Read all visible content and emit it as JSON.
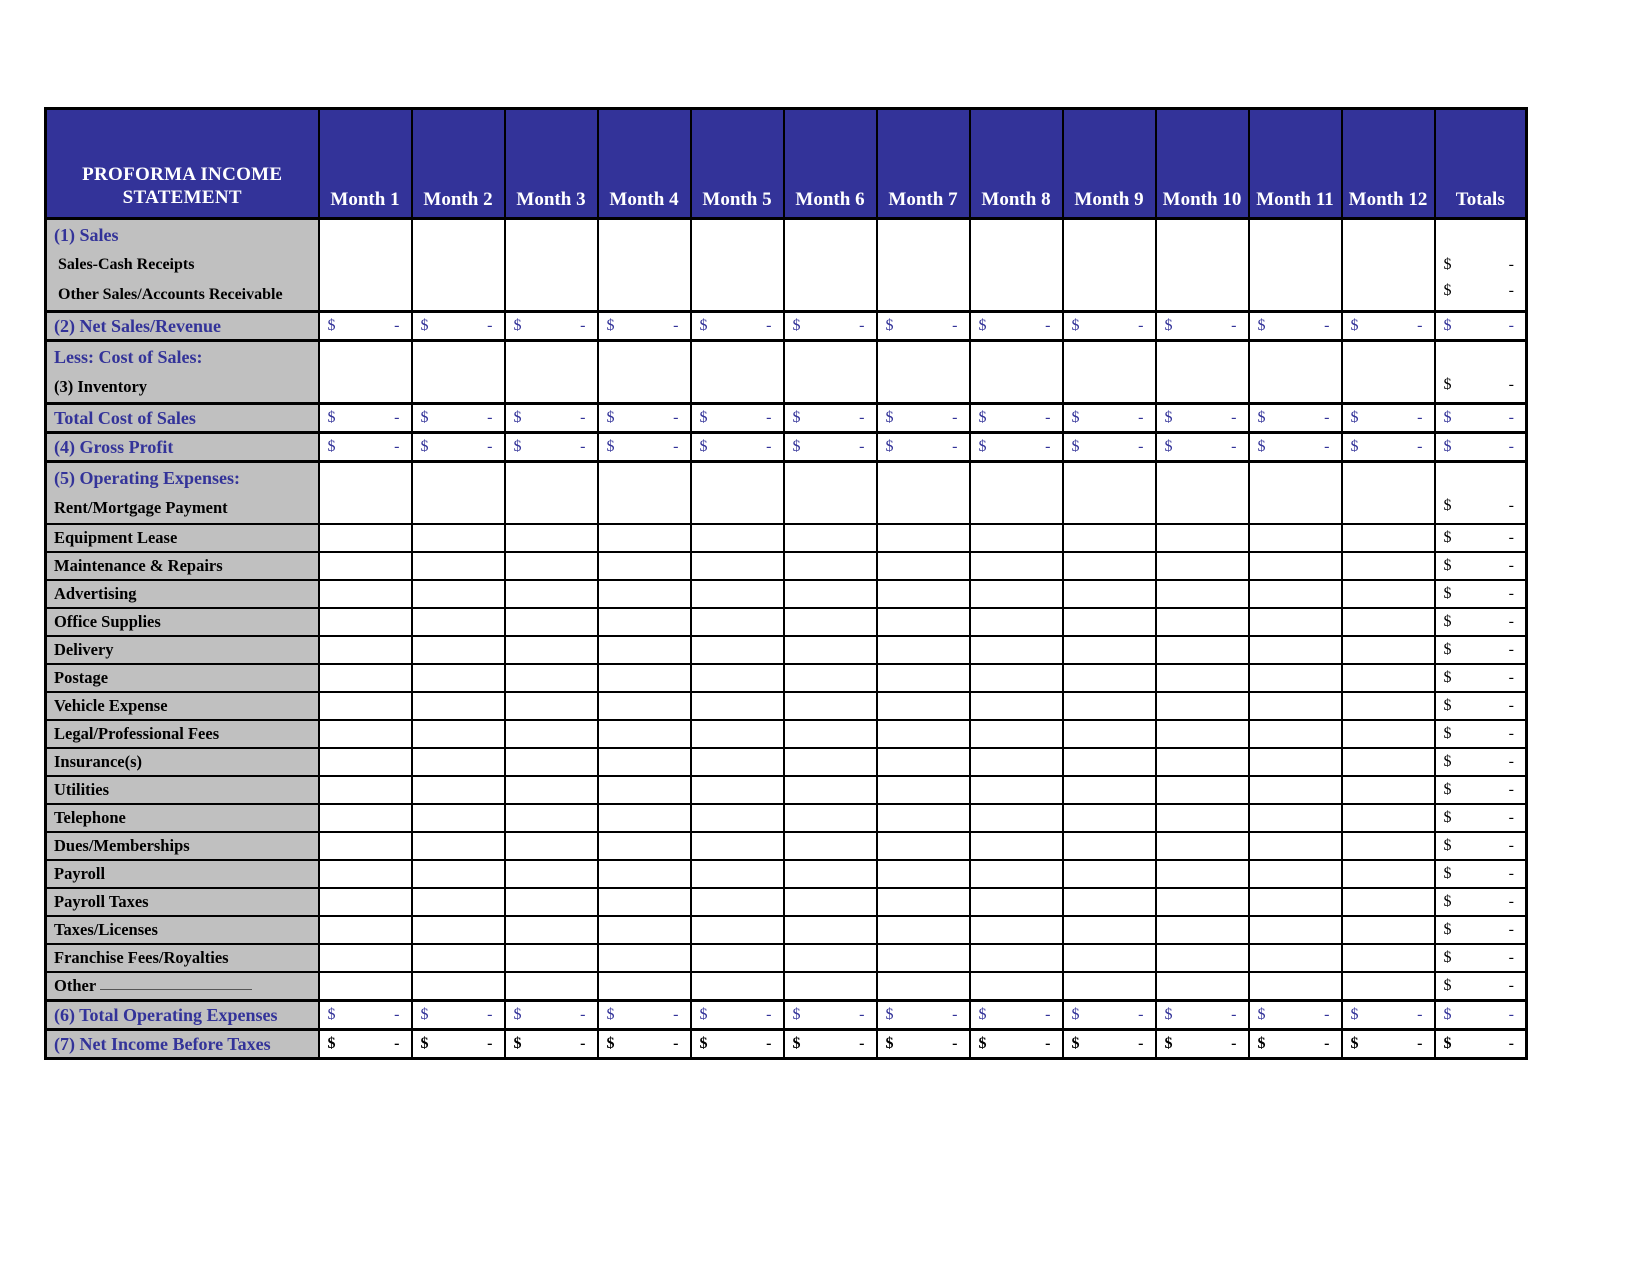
{
  "document": {
    "title_line1": "PROFORMA INCOME",
    "title_line2": "STATEMENT"
  },
  "colors": {
    "header_bg": "#333399",
    "label_bg": "#c0c0c0",
    "accent_text": "#333399",
    "cell_bg": "#ffffff",
    "border": "#000000"
  },
  "columns": {
    "row_header": "PROFORMA INCOME STATEMENT",
    "months": [
      "Month 1",
      "Month 2",
      "Month 3",
      "Month 4",
      "Month 5",
      "Month 6",
      "Month 7",
      "Month 8",
      "Month 9",
      "Month 10",
      "Month 11",
      "Month 12"
    ],
    "totals": "Totals"
  },
  "symbols": {
    "currency": "$",
    "zero_dash": "-",
    "blank": ""
  },
  "rows": {
    "sales_heading": "(1) Sales",
    "sales_cash_receipts": "Sales-Cash Receipts",
    "other_sales": "Other Sales/Accounts Receivable",
    "net_sales_revenue": "(2) Net Sales/Revenue",
    "less_cost_of_sales": "Less: Cost of Sales:",
    "inventory": "(3) Inventory",
    "total_cost_of_sales": "Total Cost of Sales",
    "gross_profit": "(4) Gross Profit",
    "operating_expenses_heading": "(5) Operating Expenses:",
    "rent_mortgage": "Rent/Mortgage Payment",
    "equipment_lease": "Equipment Lease",
    "maintenance_repairs": "Maintenance & Repairs",
    "advertising": "Advertising",
    "office_supplies": "Office Supplies",
    "delivery": "Delivery",
    "postage": "Postage",
    "vehicle_expense": "Vehicle Expense",
    "legal_professional": "Legal/Professional Fees",
    "insurances": "Insurance(s)",
    "utilities": "Utilities",
    "telephone": "Telephone",
    "dues_memberships": "Dues/Memberships",
    "payroll": "Payroll",
    "payroll_taxes": "Payroll Taxes",
    "taxes_licenses": "Taxes/Licenses",
    "franchise_fees": "Franchise Fees/Royalties",
    "other": "Other",
    "total_operating_expenses": "(6) Total Operating Expenses",
    "net_income_before_taxes": "(7) Net Income Before Taxes"
  },
  "chart_data": {
    "type": "table",
    "title": "PROFORMA INCOME STATEMENT",
    "categories": [
      "Month 1",
      "Month 2",
      "Month 3",
      "Month 4",
      "Month 5",
      "Month 6",
      "Month 7",
      "Month 8",
      "Month 9",
      "Month 10",
      "Month 11",
      "Month 12",
      "Totals"
    ],
    "series": [
      {
        "name": "(1) Sales",
        "values": [
          "",
          "",
          "",
          "",
          "",
          "",
          "",
          "",
          "",
          "",
          "",
          "",
          ""
        ]
      },
      {
        "name": "Sales-Cash Receipts",
        "values": [
          "",
          "",
          "",
          "",
          "",
          "",
          "",
          "",
          "",
          "",
          "",
          "",
          "$ -"
        ]
      },
      {
        "name": "Other Sales/Accounts Receivable",
        "values": [
          "",
          "",
          "",
          "",
          "",
          "",
          "",
          "",
          "",
          "",
          "",
          "",
          "$ -"
        ]
      },
      {
        "name": "(2) Net Sales/Revenue",
        "values": [
          "$ -",
          "$ -",
          "$ -",
          "$ -",
          "$ -",
          "$ -",
          "$ -",
          "$ -",
          "$ -",
          "$ -",
          "$ -",
          "$ -",
          "$ -"
        ]
      },
      {
        "name": "Less: Cost of Sales:",
        "values": [
          "",
          "",
          "",
          "",
          "",
          "",
          "",
          "",
          "",
          "",
          "",
          "",
          ""
        ]
      },
      {
        "name": "(3) Inventory",
        "values": [
          "",
          "",
          "",
          "",
          "",
          "",
          "",
          "",
          "",
          "",
          "",
          "",
          "$ -"
        ]
      },
      {
        "name": "Total Cost of Sales",
        "values": [
          "$ -",
          "$ -",
          "$ -",
          "$ -",
          "$ -",
          "$ -",
          "$ -",
          "$ -",
          "$ -",
          "$ -",
          "$ -",
          "$ -",
          "$ -"
        ]
      },
      {
        "name": "(4) Gross Profit",
        "values": [
          "$ -",
          "$ -",
          "$ -",
          "$ -",
          "$ -",
          "$ -",
          "$ -",
          "$ -",
          "$ -",
          "$ -",
          "$ -",
          "$ -",
          "$ -"
        ]
      },
      {
        "name": "(5) Operating Expenses:",
        "values": [
          "",
          "",
          "",
          "",
          "",
          "",
          "",
          "",
          "",
          "",
          "",
          "",
          ""
        ]
      },
      {
        "name": "Rent/Mortgage Payment",
        "values": [
          "",
          "",
          "",
          "",
          "",
          "",
          "",
          "",
          "",
          "",
          "",
          "",
          "$ -"
        ]
      },
      {
        "name": "Equipment Lease",
        "values": [
          "",
          "",
          "",
          "",
          "",
          "",
          "",
          "",
          "",
          "",
          "",
          "",
          "$ -"
        ]
      },
      {
        "name": "Maintenance & Repairs",
        "values": [
          "",
          "",
          "",
          "",
          "",
          "",
          "",
          "",
          "",
          "",
          "",
          "",
          "$ -"
        ]
      },
      {
        "name": "Advertising",
        "values": [
          "",
          "",
          "",
          "",
          "",
          "",
          "",
          "",
          "",
          "",
          "",
          "",
          "$ -"
        ]
      },
      {
        "name": "Office Supplies",
        "values": [
          "",
          "",
          "",
          "",
          "",
          "",
          "",
          "",
          "",
          "",
          "",
          "",
          "$ -"
        ]
      },
      {
        "name": "Delivery",
        "values": [
          "",
          "",
          "",
          "",
          "",
          "",
          "",
          "",
          "",
          "",
          "",
          "",
          "$ -"
        ]
      },
      {
        "name": "Postage",
        "values": [
          "",
          "",
          "",
          "",
          "",
          "",
          "",
          "",
          "",
          "",
          "",
          "",
          "$ -"
        ]
      },
      {
        "name": "Vehicle Expense",
        "values": [
          "",
          "",
          "",
          "",
          "",
          "",
          "",
          "",
          "",
          "",
          "",
          "",
          "$ -"
        ]
      },
      {
        "name": "Legal/Professional Fees",
        "values": [
          "",
          "",
          "",
          "",
          "",
          "",
          "",
          "",
          "",
          "",
          "",
          "",
          "$ -"
        ]
      },
      {
        "name": "Insurance(s)",
        "values": [
          "",
          "",
          "",
          "",
          "",
          "",
          "",
          "",
          "",
          "",
          "",
          "",
          "$ -"
        ]
      },
      {
        "name": "Utilities",
        "values": [
          "",
          "",
          "",
          "",
          "",
          "",
          "",
          "",
          "",
          "",
          "",
          "",
          "$ -"
        ]
      },
      {
        "name": "Telephone",
        "values": [
          "",
          "",
          "",
          "",
          "",
          "",
          "",
          "",
          "",
          "",
          "",
          "",
          "$ -"
        ]
      },
      {
        "name": "Dues/Memberships",
        "values": [
          "",
          "",
          "",
          "",
          "",
          "",
          "",
          "",
          "",
          "",
          "",
          "",
          "$ -"
        ]
      },
      {
        "name": "Payroll",
        "values": [
          "",
          "",
          "",
          "",
          "",
          "",
          "",
          "",
          "",
          "",
          "",
          "",
          "$ -"
        ]
      },
      {
        "name": "Payroll Taxes",
        "values": [
          "",
          "",
          "",
          "",
          "",
          "",
          "",
          "",
          "",
          "",
          "",
          "",
          "$ -"
        ]
      },
      {
        "name": "Taxes/Licenses",
        "values": [
          "",
          "",
          "",
          "",
          "",
          "",
          "",
          "",
          "",
          "",
          "",
          "",
          "$ -"
        ]
      },
      {
        "name": "Franchise Fees/Royalties",
        "values": [
          "",
          "",
          "",
          "",
          "",
          "",
          "",
          "",
          "",
          "",
          "",
          "",
          "$ -"
        ]
      },
      {
        "name": "Other",
        "values": [
          "",
          "",
          "",
          "",
          "",
          "",
          "",
          "",
          "",
          "",
          "",
          "",
          "$ -"
        ]
      },
      {
        "name": "(6) Total Operating Expenses",
        "values": [
          "$ -",
          "$ -",
          "$ -",
          "$ -",
          "$ -",
          "$ -",
          "$ -",
          "$ -",
          "$ -",
          "$ -",
          "$ -",
          "$ -",
          "$ -"
        ]
      },
      {
        "name": "(7) Net Income Before Taxes",
        "values": [
          "$ -",
          "$ -",
          "$ -",
          "$ -",
          "$ -",
          "$ -",
          "$ -",
          "$ -",
          "$ -",
          "$ -",
          "$ -",
          "$ -",
          "$ -"
        ]
      }
    ]
  }
}
